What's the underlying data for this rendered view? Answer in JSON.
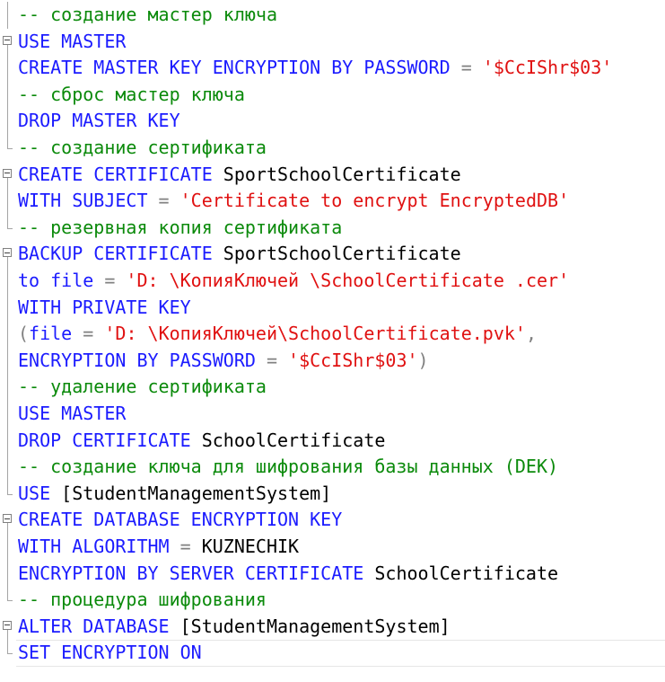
{
  "editor": {
    "language": "SQL",
    "colors": {
      "keyword": "#1b1bff",
      "comment": "#0b8a0b",
      "string": "#e01111",
      "text": "#000000",
      "operator": "#808080"
    },
    "lines": [
      {
        "gutter": "line",
        "tokens": [
          {
            "t": "-- создание мастер ключа",
            "k": "comment"
          }
        ]
      },
      {
        "gutter": "fold",
        "tokens": [
          {
            "t": "USE MASTER",
            "k": "keyword"
          }
        ]
      },
      {
        "gutter": "line",
        "tokens": [
          {
            "t": "CREATE MASTER KEY ENCRYPTION BY PASSWORD ",
            "k": "keyword"
          },
          {
            "t": "=",
            "k": "operator"
          },
          {
            "t": " ",
            "k": "text"
          },
          {
            "t": "'$CcIShr$03'",
            "k": "string"
          }
        ]
      },
      {
        "gutter": "line",
        "tokens": [
          {
            "t": "-- сброс мастер ключа",
            "k": "comment"
          }
        ]
      },
      {
        "gutter": "line",
        "tokens": [
          {
            "t": "DROP MASTER KEY",
            "k": "keyword"
          }
        ]
      },
      {
        "gutter": "end",
        "tokens": [
          {
            "t": "-- создание сертификата",
            "k": "comment"
          }
        ]
      },
      {
        "gutter": "fold",
        "tokens": [
          {
            "t": "CREATE CERTIFICATE ",
            "k": "keyword"
          },
          {
            "t": "SportSchoolCertificate",
            "k": "text"
          }
        ]
      },
      {
        "gutter": "line",
        "tokens": [
          {
            "t": "WITH SUBJECT ",
            "k": "keyword"
          },
          {
            "t": "=",
            "k": "operator"
          },
          {
            "t": " ",
            "k": "text"
          },
          {
            "t": "'Certificate to encrypt EncryptedDB'",
            "k": "string"
          }
        ]
      },
      {
        "gutter": "end",
        "tokens": [
          {
            "t": "-- резервная копия сертификата",
            "k": "comment"
          }
        ]
      },
      {
        "gutter": "fold",
        "tokens": [
          {
            "t": "BACKUP CERTIFICATE ",
            "k": "keyword"
          },
          {
            "t": "SportSchoolCertificate",
            "k": "text"
          }
        ]
      },
      {
        "gutter": "line",
        "tokens": [
          {
            "t": "to file ",
            "k": "keyword"
          },
          {
            "t": "=",
            "k": "operator"
          },
          {
            "t": " ",
            "k": "text"
          },
          {
            "t": "'D: \\КопияКлючей \\SchoolCertificate .cer'",
            "k": "string"
          }
        ]
      },
      {
        "gutter": "line",
        "tokens": [
          {
            "t": "WITH PRIVATE KEY",
            "k": "keyword"
          }
        ]
      },
      {
        "gutter": "line",
        "tokens": [
          {
            "t": "(",
            "k": "operator"
          },
          {
            "t": "file ",
            "k": "keyword"
          },
          {
            "t": "=",
            "k": "operator"
          },
          {
            "t": " ",
            "k": "text"
          },
          {
            "t": "'D: \\КопияКлючей\\SchoolCertificate.pvk'",
            "k": "string"
          },
          {
            "t": ",",
            "k": "operator"
          }
        ]
      },
      {
        "gutter": "line",
        "tokens": [
          {
            "t": "ENCRYPTION BY PASSWORD ",
            "k": "keyword"
          },
          {
            "t": "=",
            "k": "operator"
          },
          {
            "t": " ",
            "k": "text"
          },
          {
            "t": "'$CcIShr$03'",
            "k": "string"
          },
          {
            "t": ")",
            "k": "operator"
          }
        ]
      },
      {
        "gutter": "line",
        "tokens": [
          {
            "t": "-- удаление сертификата",
            "k": "comment"
          }
        ]
      },
      {
        "gutter": "line",
        "tokens": [
          {
            "t": "USE MASTER",
            "k": "keyword"
          }
        ]
      },
      {
        "gutter": "line",
        "tokens": [
          {
            "t": "DROP CERTIFICATE ",
            "k": "keyword"
          },
          {
            "t": "SchoolCertificate",
            "k": "text"
          }
        ]
      },
      {
        "gutter": "line",
        "tokens": [
          {
            "t": "-- создание ключа для шифрования базы данных (DEK)",
            "k": "comment"
          }
        ]
      },
      {
        "gutter": "end",
        "tokens": [
          {
            "t": "USE ",
            "k": "keyword"
          },
          {
            "t": "[StudentManagementSystem]",
            "k": "text"
          }
        ]
      },
      {
        "gutter": "fold",
        "tokens": [
          {
            "t": "CREATE DATABASE ENCRYPTION KEY",
            "k": "keyword"
          }
        ]
      },
      {
        "gutter": "line",
        "tokens": [
          {
            "t": "WITH ALGORITHM ",
            "k": "keyword"
          },
          {
            "t": "=",
            "k": "operator"
          },
          {
            "t": " ",
            "k": "text"
          },
          {
            "t": "KUZNECHIK",
            "k": "text"
          }
        ]
      },
      {
        "gutter": "line",
        "tokens": [
          {
            "t": "ENCRYPTION BY SERVER CERTIFICATE ",
            "k": "keyword"
          },
          {
            "t": "SchoolCertificate",
            "k": "text"
          }
        ]
      },
      {
        "gutter": "end",
        "tokens": [
          {
            "t": "-- процедура шифрования",
            "k": "comment"
          }
        ]
      },
      {
        "gutter": "fold",
        "tokens": [
          {
            "t": "ALTER DATABASE ",
            "k": "keyword"
          },
          {
            "t": "[StudentManagementSystem]",
            "k": "text"
          }
        ]
      },
      {
        "gutter": "end",
        "current": true,
        "tokens": [
          {
            "t": "SET ENCRYPTION ON",
            "k": "keyword"
          }
        ]
      }
    ]
  }
}
